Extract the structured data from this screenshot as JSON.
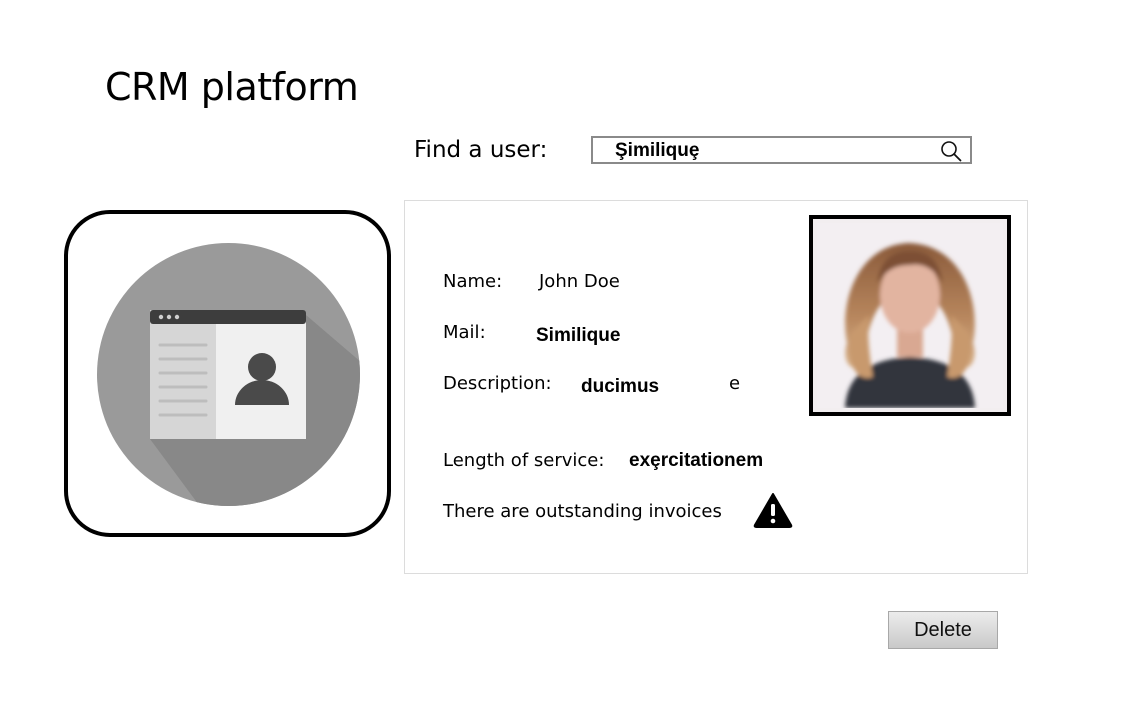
{
  "header": {
    "title": "CRM platform"
  },
  "search": {
    "label": "Find a user:",
    "value": "Şimiliquȩ",
    "icon": "search-icon"
  },
  "profile_card": {
    "icon": "contact-card-icon",
    "fields": {
      "name_label": "Name:",
      "name_value": "John Doe",
      "mail_label": "Mail:",
      "mail_value": "Similique",
      "description_label": "Description:",
      "description_value": "ducimus",
      "description_trailing": "e",
      "service_label": "Length of service:",
      "service_value": "exȩrcitationem"
    },
    "notice": {
      "text": "There are outstanding invoices",
      "icon": "warning-icon"
    },
    "photo": {
      "icon": "user-photo"
    }
  },
  "actions": {
    "delete_label": "Delete"
  },
  "colors": {
    "border": "#000000",
    "card_border": "#dcdcdc",
    "icon_circle": "#9a9a9a",
    "button_top": "#ececec",
    "button_bottom": "#c9c9c9"
  }
}
